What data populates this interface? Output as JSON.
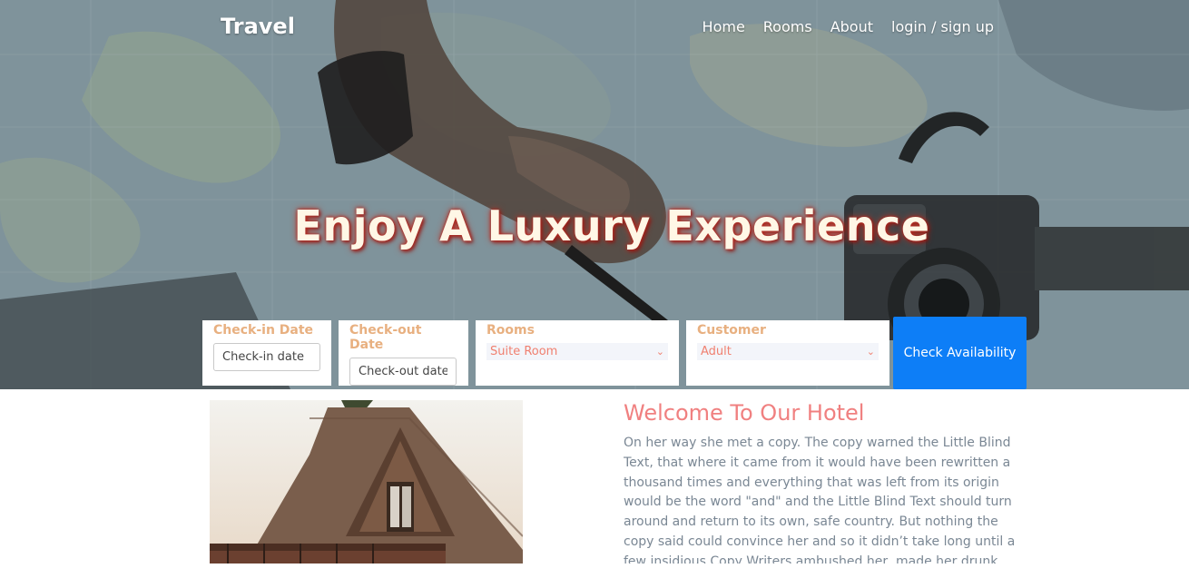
{
  "brand": "Travel",
  "nav": {
    "home": "Home",
    "rooms": "Rooms",
    "about": "About",
    "login": "login / sign up"
  },
  "hero": {
    "headline": "Enjoy A Luxury Experience"
  },
  "booking": {
    "checkin_label": "Check-in Date",
    "checkin_placeholder": "Check-in date",
    "checkout_label": "Check-out Date",
    "checkout_placeholder": "Check-out date",
    "rooms_label": "Rooms",
    "rooms_value": "Suite Room",
    "customer_label": "Customer",
    "customer_value": "Adult",
    "button": "Check Availability"
  },
  "welcome": {
    "title": "Welcome To Our Hotel",
    "text": "On her way she met a copy. The copy warned the Little Blind Text, that where it came from it would have been rewritten a thousand times and everything that was left from its origin would be the word \"and\" and the Little Blind Text should turn around and return to its own, safe country. But nothing the copy said could convince her and so it didn’t take long until a few insidious Copy Writers ambushed her, made her drunk with"
  },
  "colors": {
    "accent_blue": "#0d7ef7",
    "label_orange": "#e8b080",
    "title_salmon": "#f08080",
    "body_gray": "#7a8794"
  },
  "icons": {
    "select_chevron": "chevron-down-icon"
  }
}
